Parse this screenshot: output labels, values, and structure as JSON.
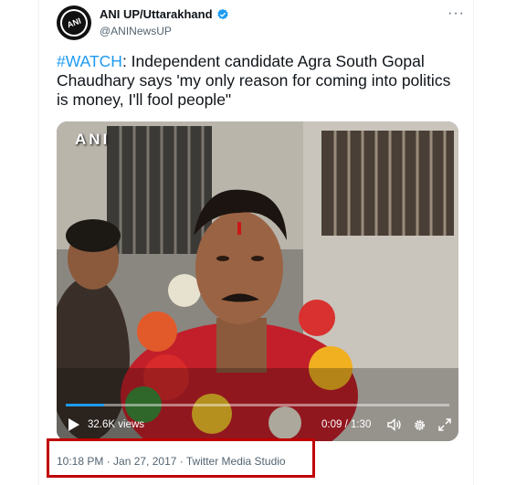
{
  "tweet": {
    "display_name": "ANI UP/Uttarakhand",
    "handle": "@ANINewsUP",
    "avatar_text": "ANI",
    "hashtag": "#WATCH",
    "body": ": Independent candidate Agra South Gopal Chaudhary says 'my only reason for coming into politics is money, I'll fool people\"",
    "more_label": "···"
  },
  "video": {
    "watermark": "ANI",
    "views": "32.6K views",
    "time": "0:09 / 1:30",
    "progress": 0.1,
    "accent_color": "#1d9bf0"
  },
  "meta": {
    "timestamp": "10:18 PM · Jan 27, 2017 · Twitter Media Studio"
  },
  "highlight_color": "#c00000"
}
